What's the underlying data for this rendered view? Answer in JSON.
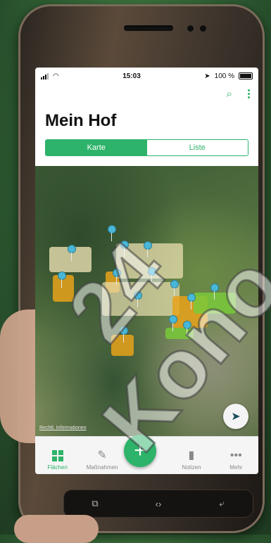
{
  "status": {
    "time": "15:03",
    "battery": "100 %"
  },
  "header": {
    "title": "Mein Hof"
  },
  "segments": {
    "map_label": "Karte",
    "list_label": "Liste",
    "selected": "Karte"
  },
  "map": {
    "legal_label": "Rechtl. Informationen"
  },
  "tabbar": {
    "items": [
      {
        "label": "Flächen",
        "icon": "grid-icon",
        "active": true
      },
      {
        "label": "Maßnahmen",
        "icon": "pencil-icon"
      },
      {
        "label": "",
        "icon": "plus-icon"
      },
      {
        "label": "Notizen",
        "icon": "note-icon"
      },
      {
        "label": "Mehr",
        "icon": "more-icon"
      }
    ]
  },
  "colors": {
    "accent": "#2db36a",
    "pin": "#4ab7d6",
    "field_orange": "#e8a21a",
    "field_cream": "#e9dfb0",
    "field_green": "#79c93a"
  },
  "watermark": {
    "text": "24 Kono"
  }
}
